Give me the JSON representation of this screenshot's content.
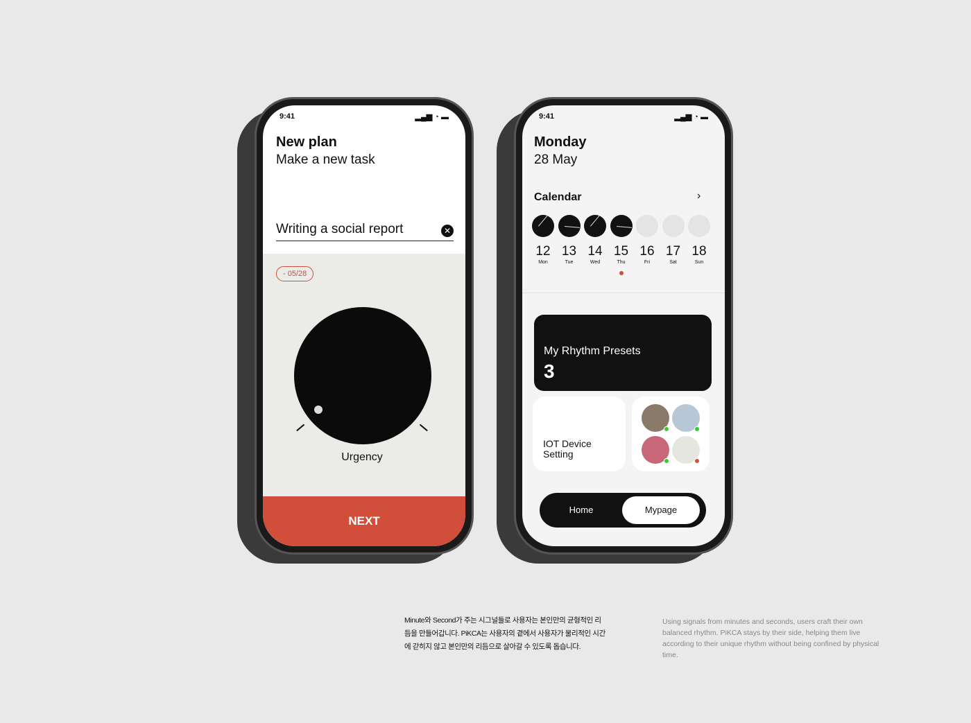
{
  "left_phone": {
    "time": "9:41",
    "title": "New plan",
    "subtitle": "Make a new task",
    "task_input": "Writing a social report",
    "date_badge": "- 05/28",
    "dial_label": "Urgency",
    "next_label": "NEXT"
  },
  "right_phone": {
    "time": "9:41",
    "day": "Monday",
    "date": "28 May",
    "calendar_label": "Calendar",
    "days": [
      {
        "num": "12",
        "name": "Mon",
        "filled": true
      },
      {
        "num": "13",
        "name": "Tue",
        "filled": true
      },
      {
        "num": "14",
        "name": "Wed",
        "filled": true
      },
      {
        "num": "15",
        "name": "Thu",
        "filled": true,
        "today": true
      },
      {
        "num": "16",
        "name": "Fri",
        "filled": false
      },
      {
        "num": "17",
        "name": "Sat",
        "filled": false
      },
      {
        "num": "18",
        "name": "Sun",
        "filled": false
      }
    ],
    "presets_label": "My Rhythm Presets",
    "presets_count": "3",
    "iot_label": "IOT Device Setting",
    "nav": {
      "home": "Home",
      "mypage": "Mypage"
    }
  },
  "captions": {
    "korean": "Minute와 Second가 주는 시그널들로 사용자는 본인만의 균형적인 리듬을 만들어갑니다. PiKCA는 사용자의 곁에서 사용자가 물리적인 시간에 갇히지 않고 본인만의 리듬으로 살아갈 수 있도록 돕습니다.",
    "english": "Using signals from minutes and seconds, users craft their own balanced rhythm. PiKCA stays by their side, helping them live according to their unique rhythm without being confined by physical time."
  },
  "colors": {
    "accent": "#d04e3a",
    "dark": "#111111"
  }
}
